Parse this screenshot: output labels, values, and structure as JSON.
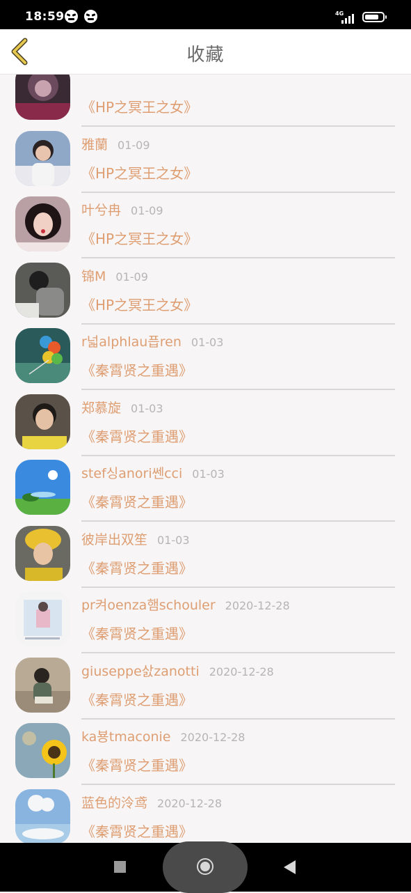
{
  "status_bar": {
    "time": "18:59",
    "network": "4G",
    "battery_level": 0.8
  },
  "header": {
    "title": "收藏",
    "back_icon": "chevron-left-icon"
  },
  "favorites": [
    {
      "name": "",
      "date": "",
      "book": "《HP之冥王之女》",
      "avatar": "dark-anime-portrait"
    },
    {
      "name": "雅蘭",
      "date": "01-09",
      "book": "《HP之冥王之女》",
      "avatar": "girl-portrait"
    },
    {
      "name": "叶兮冉",
      "date": "01-09",
      "book": "《HP之冥王之女》",
      "avatar": "woman-red-portrait"
    },
    {
      "name": "锦M",
      "date": "01-09",
      "book": "《HP之冥王之女》",
      "avatar": "backpack-photo"
    },
    {
      "name": "r넓alphlau픕ren",
      "date": "01-03",
      "book": "《秦霄贤之重遇》",
      "avatar": "balloons"
    },
    {
      "name": "郑慕旋",
      "date": "01-03",
      "book": "《秦霄贤之重遇》",
      "avatar": "boy-portrait"
    },
    {
      "name": "stef싱anori쎈cci",
      "date": "01-03",
      "book": "《秦霄贤之重遇》",
      "avatar": "sky-landscape"
    },
    {
      "name": "彼岸出双笙",
      "date": "01-03",
      "book": "《秦霄贤之重遇》",
      "avatar": "boy-yellow-hat"
    },
    {
      "name": "pr켜oenza햄schouler",
      "date": "2020-12-28",
      "book": "《秦霄贤之重遇》",
      "avatar": "illustration-card"
    },
    {
      "name": "giuseppe삸zanotti",
      "date": "2020-12-28",
      "book": "《秦霄贤之重遇》",
      "avatar": "reading-girl"
    },
    {
      "name": "ka뵹tmaconie",
      "date": "2020-12-28",
      "book": "《秦霄贤之重遇》",
      "avatar": "sunflower"
    },
    {
      "name": "蓝色的泠鸢",
      "date": "2020-12-28",
      "book": "《秦霄贤之重遇》",
      "avatar": "clouds"
    }
  ],
  "nav": {
    "recents": "square-icon",
    "home": "home-circle-icon",
    "back": "triangle-back-icon"
  }
}
